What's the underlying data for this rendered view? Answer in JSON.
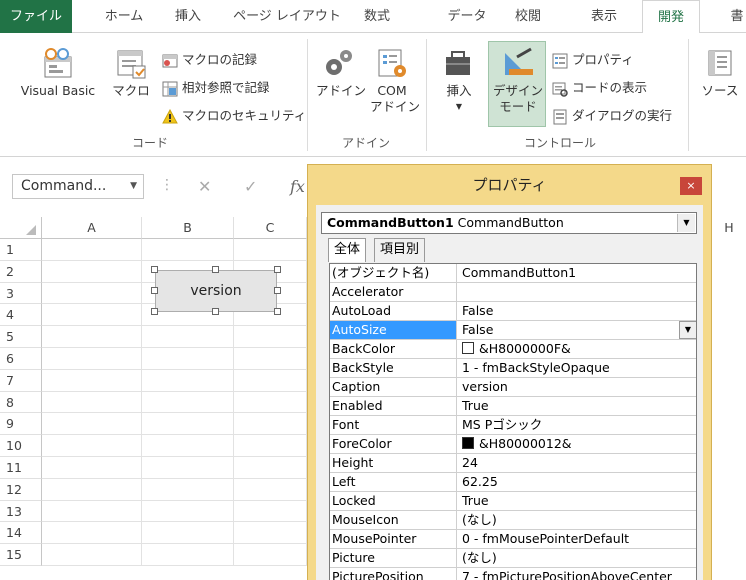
{
  "tabs": [
    {
      "label": "ファイル"
    },
    {
      "label": "ホーム"
    },
    {
      "label": "挿入"
    },
    {
      "label": "ページ レイアウト"
    },
    {
      "label": "数式"
    },
    {
      "label": "データ"
    },
    {
      "label": "校閲"
    },
    {
      "label": "表示"
    },
    {
      "label": "開発"
    },
    {
      "label": "書"
    }
  ],
  "ribbon": {
    "code": {
      "visual_basic": "Visual Basic",
      "macro": "マクロ",
      "record_macro": "マクロの記録",
      "relative_ref": "相対参照で記録",
      "macro_security": "マクロのセキュリティ",
      "group_label": "コード"
    },
    "addins": {
      "addin": "アドイン",
      "com_addin_1": "COM",
      "com_addin_2": "アドイン",
      "group_label": "アドイン"
    },
    "controls": {
      "insert": "挿入",
      "design_mode_1": "デザイン",
      "design_mode_2": "モード",
      "properties": "プロパティ",
      "view_code": "コードの表示",
      "run_dialog": "ダイアログの実行",
      "group_label": "コントロール"
    },
    "source": "ソース"
  },
  "formula_bar": {
    "name_box": "Command...",
    "fx": "fx"
  },
  "grid": {
    "columns": [
      "A",
      "B",
      "C"
    ],
    "extra_column": "H",
    "rows": [
      "1",
      "2",
      "3",
      "4",
      "5",
      "6",
      "7",
      "8",
      "9",
      "10",
      "11",
      "12",
      "13",
      "14",
      "15"
    ]
  },
  "command_button": {
    "caption": "version"
  },
  "properties_window": {
    "title": "プロパティ",
    "close": "×",
    "object_name": "CommandButton1",
    "object_type": "CommandButton",
    "tabs": [
      "全体",
      "項目別"
    ],
    "rows": [
      {
        "name": "(オブジェクト名)",
        "value": "CommandButton1"
      },
      {
        "name": "Accelerator",
        "value": ""
      },
      {
        "name": "AutoLoad",
        "value": "False"
      },
      {
        "name": "AutoSize",
        "value": "False"
      },
      {
        "name": "BackColor",
        "value": "&H8000000F&"
      },
      {
        "name": "BackStyle",
        "value": "1 - fmBackStyleOpaque"
      },
      {
        "name": "Caption",
        "value": "version"
      },
      {
        "name": "Enabled",
        "value": "True"
      },
      {
        "name": "Font",
        "value": "MS Pゴシック"
      },
      {
        "name": "ForeColor",
        "value": "&H80000012&"
      },
      {
        "name": "Height",
        "value": "24"
      },
      {
        "name": "Left",
        "value": "62.25"
      },
      {
        "name": "Locked",
        "value": "True"
      },
      {
        "name": "MouseIcon",
        "value": "(なし)"
      },
      {
        "name": "MousePointer",
        "value": "0 - fmMousePointerDefault"
      },
      {
        "name": "Picture",
        "value": "(なし)"
      },
      {
        "name": "PicturePosition",
        "value": "7 - fmPicturePositionAboveCenter"
      }
    ],
    "colors": {
      "backcolor_swatch": "#ffffff",
      "forecolor_swatch": "#000000",
      "selected_row": "#3399ff"
    }
  },
  "colors": {
    "file_tab": "#217346",
    "active_tab_text": "#217346",
    "properties_frame": "#f4d98a",
    "close_button": "#c8463a"
  }
}
